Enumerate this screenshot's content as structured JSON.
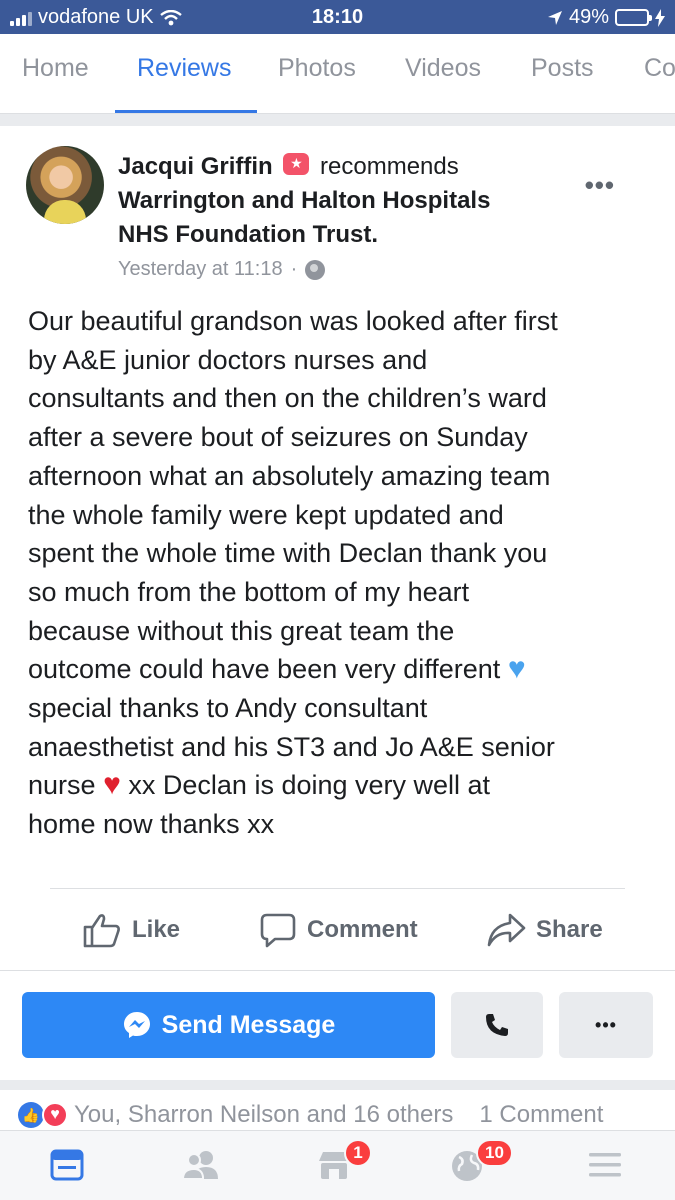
{
  "status_bar": {
    "carrier": "vodafone UK",
    "time": "18:10",
    "battery": "49%"
  },
  "tabs": [
    {
      "label": "Home"
    },
    {
      "label": "Reviews"
    },
    {
      "label": "Photos"
    },
    {
      "label": "Videos"
    },
    {
      "label": "Posts"
    },
    {
      "label": "Co"
    }
  ],
  "post": {
    "author": "Jacqui Griffin",
    "action": "recommends",
    "page_name_line1": "Warrington and Halton Hospitals",
    "page_name_line2": "NHS Foundation Trust.",
    "timestamp": "Yesterday at 11:18",
    "body_lines": [
      "Our beautiful grandson was looked after first",
      "by A&E junior doctors nurses and",
      "consultants and then on the children’s ward",
      "after a severe bout of seizures on Sunday",
      "afternoon what an absolutely amazing team",
      "the whole family were kept updated and",
      "spent the whole time with Declan thank you",
      "so much from the bottom of my heart",
      "because without this great team the",
      "outcome could have been very different",
      "special thanks to Andy consultant",
      "anaesthetist and his ST3 and Jo A&E senior",
      "nurse",
      "xx Declan is doing very well at",
      "home now thanks xx"
    ],
    "like_label": "Like",
    "comment_label": "Comment",
    "share_label": "Share"
  },
  "cta": {
    "send_message_label": "Send Message"
  },
  "reactions": {
    "summary": "You, Sharron Neilson and 16 others",
    "comments": "1 Comment"
  },
  "bottom_nav": {
    "marketplace_badge": "1",
    "notifications_badge": "10"
  },
  "colors": {
    "status_bar": "#3b5998",
    "accent": "#3578e5",
    "send_button": "#2d88f5",
    "badge": "#fa3e3e"
  }
}
